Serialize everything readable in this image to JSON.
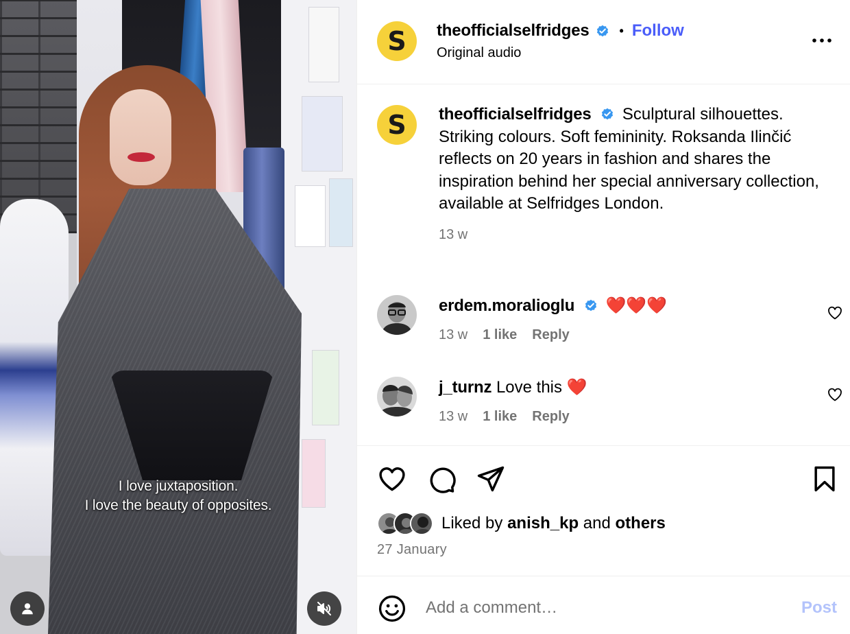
{
  "colors": {
    "follow": "#4a5df9",
    "verified": "#3897f0",
    "post_disabled": "#b3c3fb",
    "secondary_text": "#737373",
    "selfridges_yellow": "#f6d13a",
    "heart_red": "#e0245e"
  },
  "media": {
    "subtitle_line1": "I love juxtaposition.",
    "subtitle_line2": "I love the beauty of opposites.",
    "user_tags_icon": "person-icon",
    "audio_icon": "speaker-muted-icon"
  },
  "header": {
    "avatar_letter": "S",
    "username": "theofficialselfridges",
    "dot": "•",
    "follow_label": "Follow",
    "subline": "Original audio",
    "more_icon": "more-horizontal-icon"
  },
  "caption": {
    "avatar_letter": "S",
    "username": "theofficialselfridges",
    "text": "Sculptural silhouettes. Striking colours. Soft femininity. Roksanda Ilinčić reflects on 20 years in fashion and shares the inspiration behind her special anniversary collection, available at Selfridges London.",
    "time": "13 w"
  },
  "comments": [
    {
      "username": "erdem.moralioglu",
      "verified": true,
      "text": "❤️❤️❤️",
      "time": "13 w",
      "likes": "1 like",
      "reply": "Reply"
    },
    {
      "username": "j_turnz",
      "verified": false,
      "text": "Love this ❤️",
      "time": "13 w",
      "likes": "1 like",
      "reply": "Reply"
    }
  ],
  "actions": {
    "liked_prefix": "Liked by",
    "liked_user": "anish_kp",
    "liked_and": "and",
    "liked_others": "others",
    "date": "27 January"
  },
  "comment_box": {
    "placeholder": "Add a comment…",
    "post_label": "Post"
  }
}
